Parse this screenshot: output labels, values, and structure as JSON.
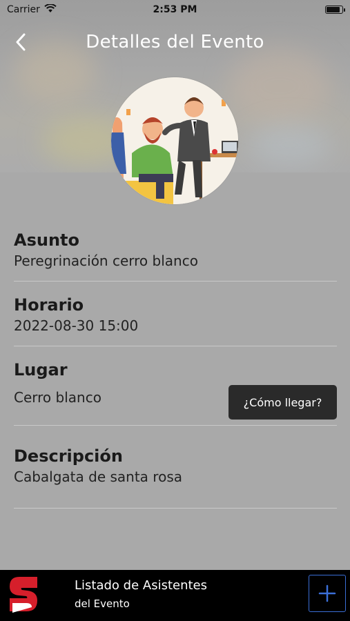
{
  "status_bar": {
    "carrier": "Carrier",
    "time": "2:53 PM"
  },
  "nav": {
    "title": "Detalles del Evento",
    "back_icon": "chevron-left-icon"
  },
  "event": {
    "subject": {
      "label": "Asunto",
      "value": "Peregrinación cerro blanco"
    },
    "schedule": {
      "label": "Horario",
      "value": "2022-08-30 15:00"
    },
    "place": {
      "label": "Lugar",
      "value": "Cerro blanco",
      "directions_button": "¿Cómo llegar?"
    },
    "description": {
      "label": "Descripción",
      "value": "Cabalgata de santa rosa"
    }
  },
  "bottom_bar": {
    "title": "Listado de Asistentes",
    "subtitle": "del Evento",
    "add_icon": "plus-icon",
    "logo_icon": "s-logo-icon"
  },
  "colors": {
    "background": "#a9a9a9",
    "button_dark": "#2a2a2a",
    "bottom_bar": "#000000",
    "add_border": "#3b6fd8",
    "logo_red": "#d61f2b"
  }
}
